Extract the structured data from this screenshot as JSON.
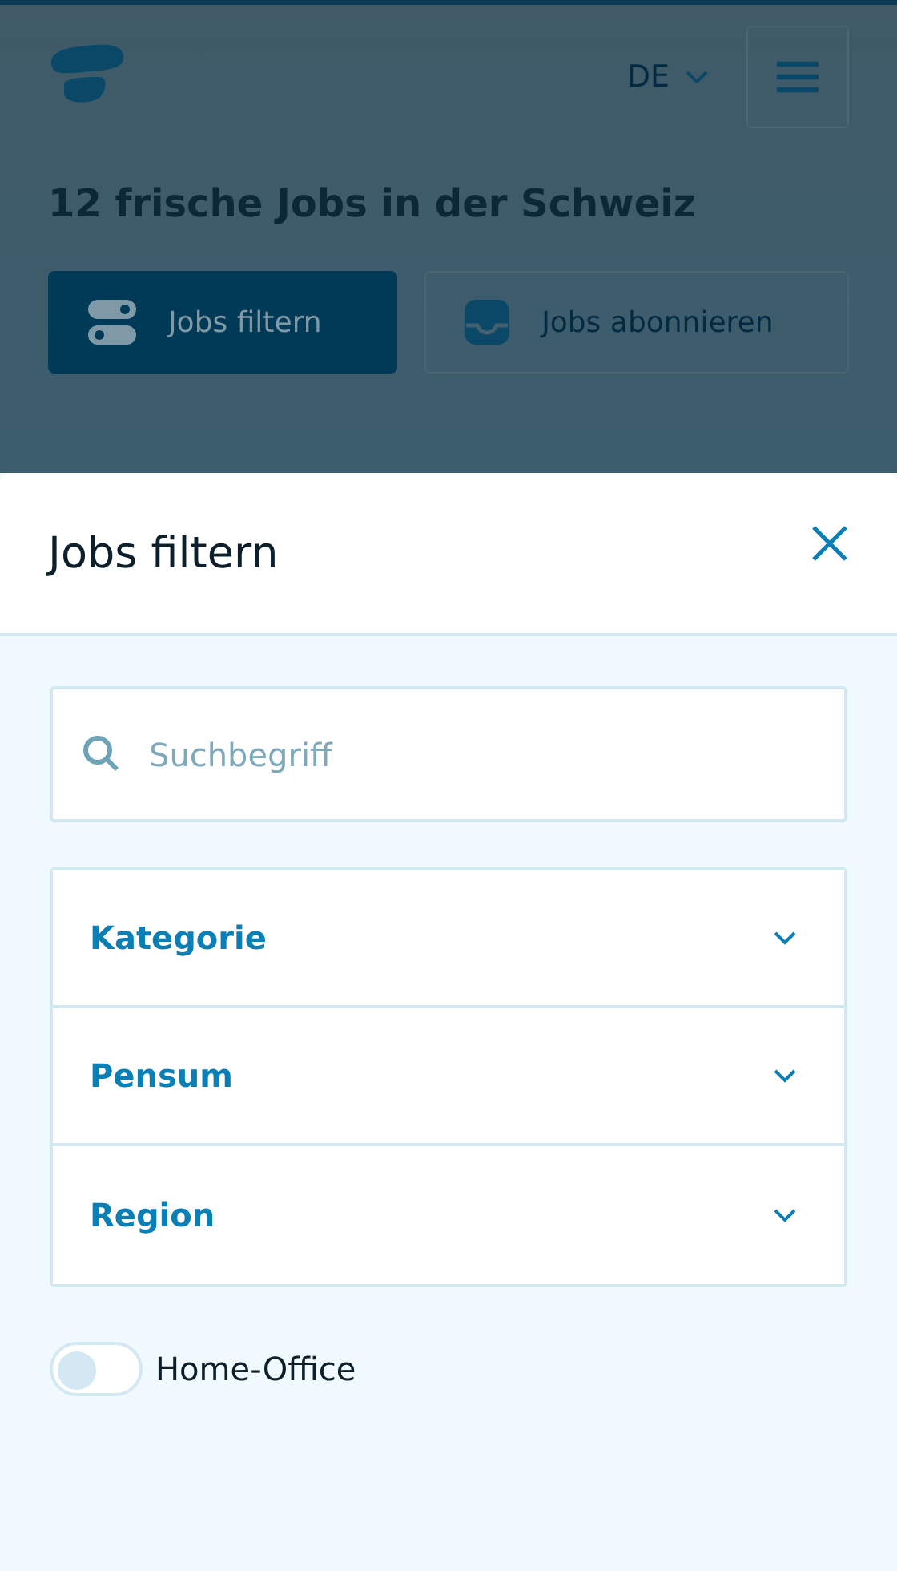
{
  "header": {
    "language": "DE"
  },
  "headline": "12 frische Jobs in der Schweiz",
  "actions": [
    {
      "label": "Jobs filtern",
      "kind": "filter",
      "selected": true
    },
    {
      "label": "Jobs abonnieren",
      "kind": "subscribe",
      "selected": false
    }
  ],
  "sheet": {
    "title": "Jobs filtern",
    "search": {
      "placeholder": "Suchbegriff"
    },
    "filters": [
      {
        "label": "Kategorie",
        "expanded": false
      },
      {
        "label": "Pensum",
        "expanded": false
      },
      {
        "label": "Region",
        "expanded": false
      }
    ],
    "toggle": {
      "label": "Home-Office",
      "on": false
    }
  }
}
